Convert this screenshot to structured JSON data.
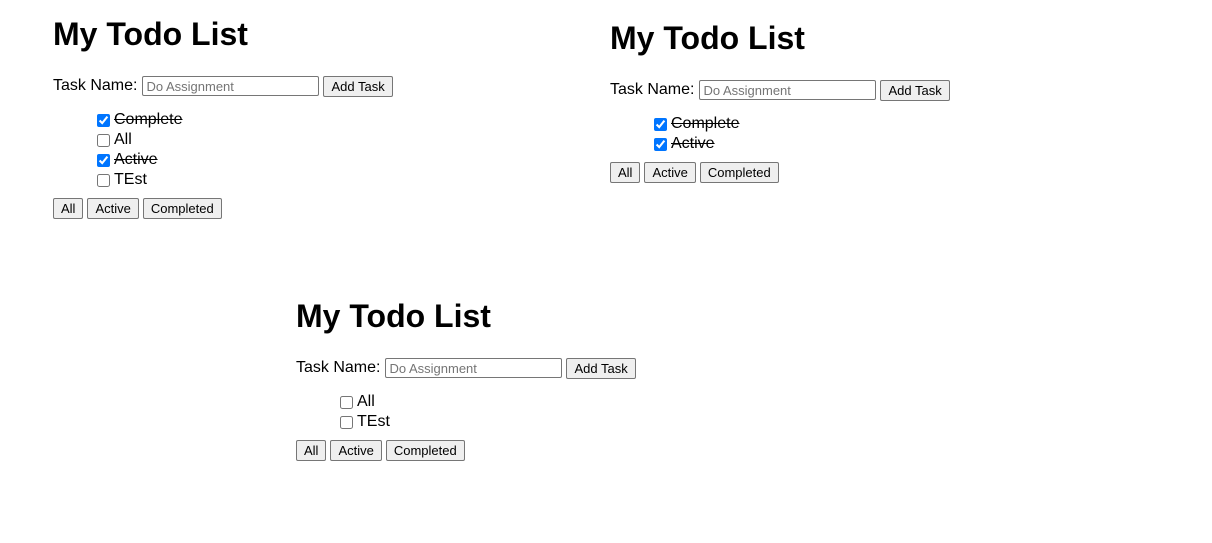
{
  "title": "My Todo List",
  "form": {
    "label": "Task Name:",
    "placeholder": "Do Assignment",
    "value": "",
    "add_button": "Add Task"
  },
  "filters": [
    "All",
    "Active",
    "Completed"
  ],
  "panels": [
    {
      "tasks": [
        {
          "text": " Complete",
          "checked": true
        },
        {
          "text": "All",
          "checked": false
        },
        {
          "text": " Active",
          "checked": true
        },
        {
          "text": "TEst",
          "checked": false
        }
      ]
    },
    {
      "tasks": [
        {
          "text": " Complete",
          "checked": true
        },
        {
          "text": " Active",
          "checked": true
        }
      ]
    },
    {
      "tasks": [
        {
          "text": "All",
          "checked": false
        },
        {
          "text": "TEst",
          "checked": false
        }
      ]
    }
  ]
}
